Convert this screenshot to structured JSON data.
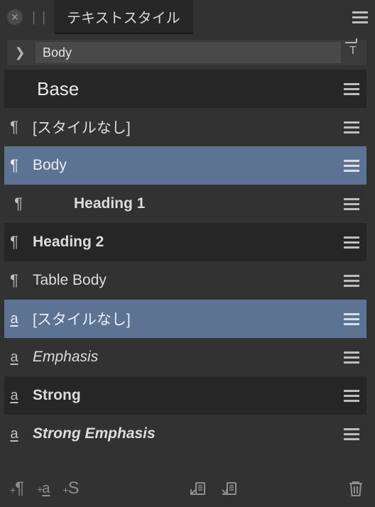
{
  "panel": {
    "tab_title": "テキストスタイル"
  },
  "breadcrumb": {
    "current": "Body"
  },
  "styles": {
    "group_label": "Base",
    "items": [
      {
        "label": "[スタイルなし]"
      },
      {
        "label": "Body"
      },
      {
        "label": "Heading 1"
      },
      {
        "label": "Heading 2"
      },
      {
        "label": "Table Body"
      },
      {
        "label": "[スタイルなし]"
      },
      {
        "label": "Emphasis"
      },
      {
        "label": "Strong"
      },
      {
        "label": "Strong Emphasis"
      }
    ]
  },
  "footer": {
    "new_paragraph": "¶",
    "new_character": "a",
    "new_stylegroup": "S"
  }
}
